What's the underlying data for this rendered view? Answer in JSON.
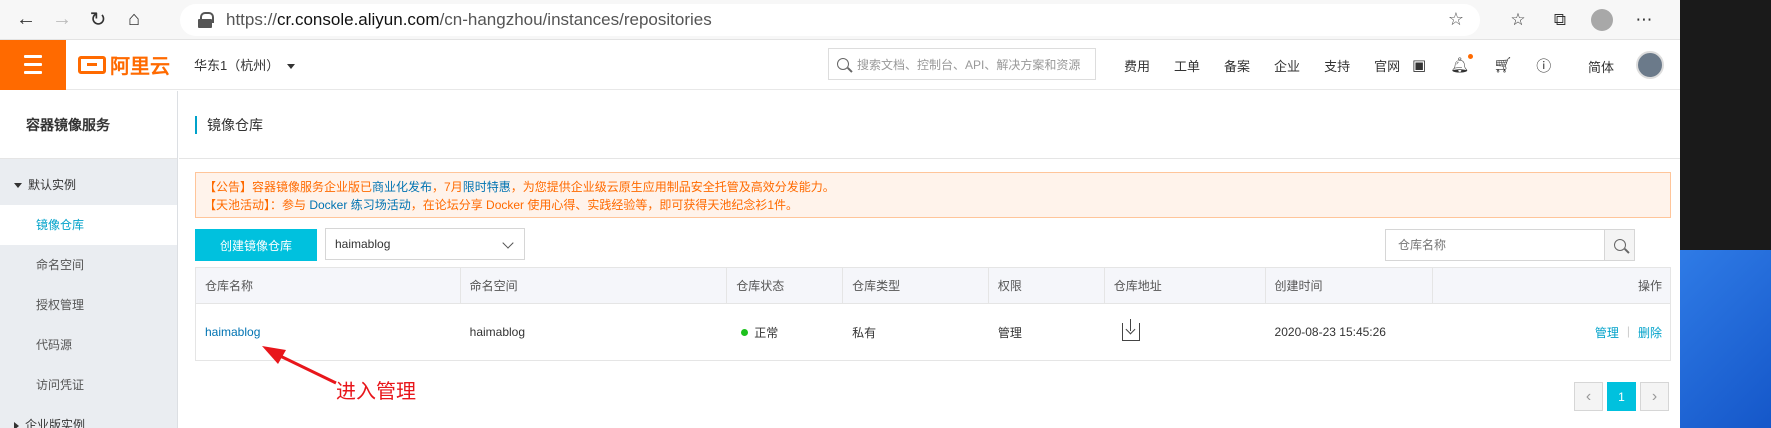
{
  "browser": {
    "url_prefix": "https://",
    "url_host": "cr.console.aliyun.com",
    "url_path": "/cn-hangzhou/instances/repositories"
  },
  "topbar": {
    "logo_text": "阿里云",
    "region": "华东1（杭州）",
    "search_placeholder": "搜索文档、控制台、API、解决方案和资源",
    "links": [
      "费用",
      "工单",
      "备案",
      "企业",
      "支持",
      "官网"
    ],
    "lang": "简体"
  },
  "sidebar": {
    "title": "容器镜像服务",
    "group_default": "默认实例",
    "items": [
      "镜像仓库",
      "命名空间",
      "授权管理",
      "代码源",
      "访问凭证"
    ],
    "group_enterprise": "企业版实例"
  },
  "main": {
    "title": "镜像仓库",
    "notice": {
      "line1_a": "【公告】容器镜像服务企业版已",
      "line1_link1": "商业化发布",
      "line1_b": "，7月",
      "line1_link2": "限时特惠",
      "line1_c": "，为您提供企业级云原生应用制品安全托管及高效分发能力。",
      "line2_a": "【天池活动】：参与 ",
      "line2_link": "Docker 练习场活动",
      "line2_b": "，在论坛分享 Docker 使用心得、实践经验等，即可获得天池纪念衫1件。"
    },
    "create_button": "创建镜像仓库",
    "namespace_select": "haimablog",
    "search_placeholder": "仓库名称",
    "table": {
      "headers": [
        "仓库名称",
        "命名空间",
        "仓库状态",
        "仓库类型",
        "权限",
        "仓库地址",
        "创建时间",
        "操作"
      ],
      "row": {
        "name": "haimablog",
        "namespace": "haimablog",
        "status": "正常",
        "type": "私有",
        "permission": "管理",
        "created": "2020-08-23 15:45:26",
        "op_manage": "管理",
        "op_sep": "|",
        "op_delete": "删除"
      }
    },
    "pagination": {
      "current": "1"
    }
  },
  "annotation": {
    "text": "进入管理",
    "color": "#e8161b"
  }
}
